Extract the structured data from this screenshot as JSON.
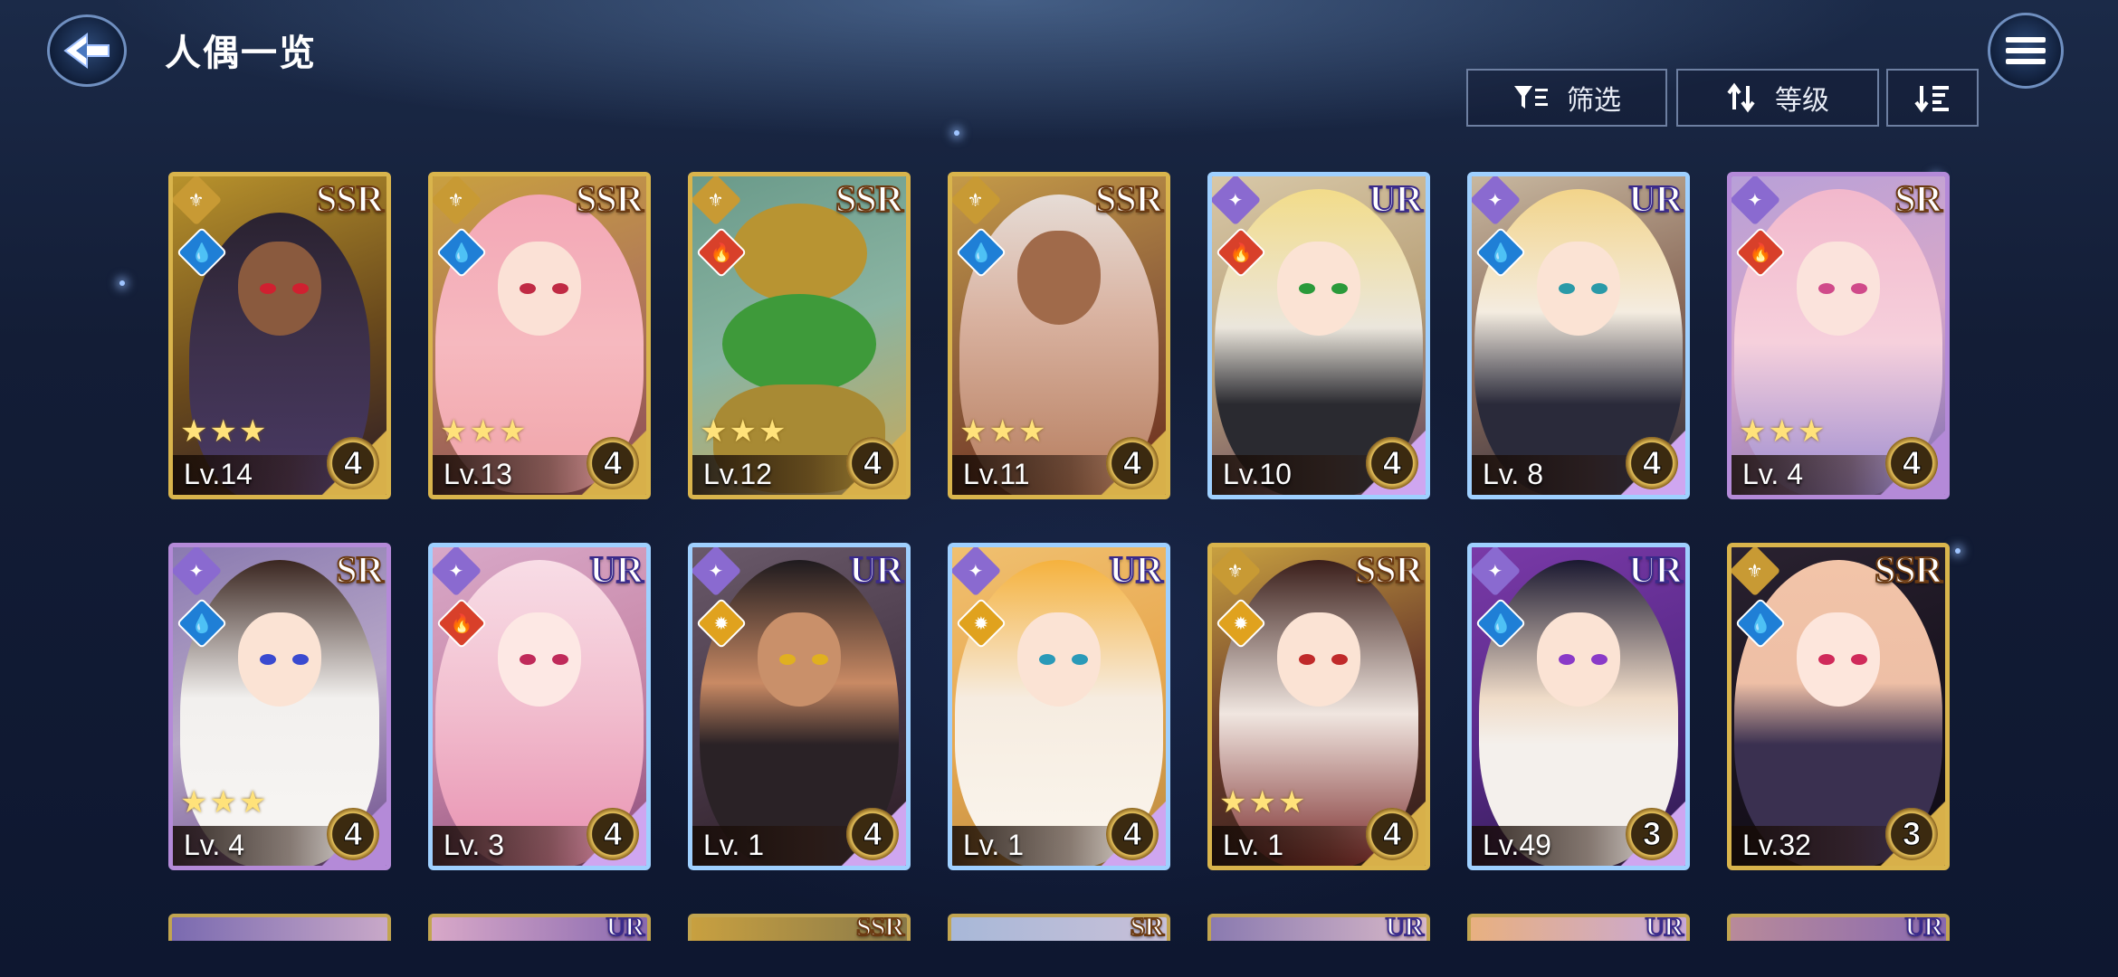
{
  "header": {
    "title": "人偶一览",
    "back_icon": "back-arrow-icon",
    "menu_icon": "hamburger-menu-icon"
  },
  "toolbar": {
    "filter_label": "筛选",
    "filter_icon": "filter-icon",
    "sort_label": "等级",
    "sort_icon": "sort-arrows-icon",
    "order_icon": "sort-order-icon"
  },
  "cards": [
    {
      "rarity": "SSR",
      "element": "water",
      "stars": "★★★",
      "level": "Lv.14",
      "tier": "4"
    },
    {
      "rarity": "SSR",
      "element": "water",
      "stars": "★★★",
      "level": "Lv.13",
      "tier": "4"
    },
    {
      "rarity": "SSR",
      "element": "fire",
      "stars": "★★★",
      "level": "Lv.12",
      "tier": "4"
    },
    {
      "rarity": "SSR",
      "element": "water",
      "stars": "★★★",
      "level": "Lv.11",
      "tier": "4"
    },
    {
      "rarity": "UR",
      "element": "fire",
      "stars": "",
      "level": "Lv.10",
      "tier": "4"
    },
    {
      "rarity": "UR",
      "element": "water",
      "stars": "",
      "level": "Lv. 8",
      "tier": "4"
    },
    {
      "rarity": "SR",
      "element": "fire",
      "stars": "★★★",
      "level": "Lv. 4",
      "tier": "4"
    },
    {
      "rarity": "SR",
      "element": "water",
      "stars": "★★★",
      "level": "Lv. 4",
      "tier": "4"
    },
    {
      "rarity": "UR",
      "element": "fire",
      "stars": "",
      "level": "Lv. 3",
      "tier": "4"
    },
    {
      "rarity": "UR",
      "element": "light",
      "stars": "",
      "level": "Lv. 1",
      "tier": "4"
    },
    {
      "rarity": "UR",
      "element": "light",
      "stars": "",
      "level": "Lv. 1",
      "tier": "4"
    },
    {
      "rarity": "SSR",
      "element": "light",
      "stars": "★★★",
      "level": "Lv. 1",
      "tier": "4"
    },
    {
      "rarity": "UR",
      "element": "water",
      "stars": "",
      "level": "Lv.49",
      "tier": "3"
    },
    {
      "rarity": "SSR",
      "element": "water",
      "stars": "",
      "level": "Lv.32",
      "tier": "3"
    }
  ],
  "peek_cards": [
    "",
    "UR",
    "SSR",
    "SR",
    "UR",
    "UR",
    "UR"
  ],
  "colors": {
    "gold_frame": "#d9b44c",
    "purple_frame": "#b48ad8",
    "water": "#1f7fd6",
    "fire": "#d8402a",
    "light": "#e0a21e"
  }
}
